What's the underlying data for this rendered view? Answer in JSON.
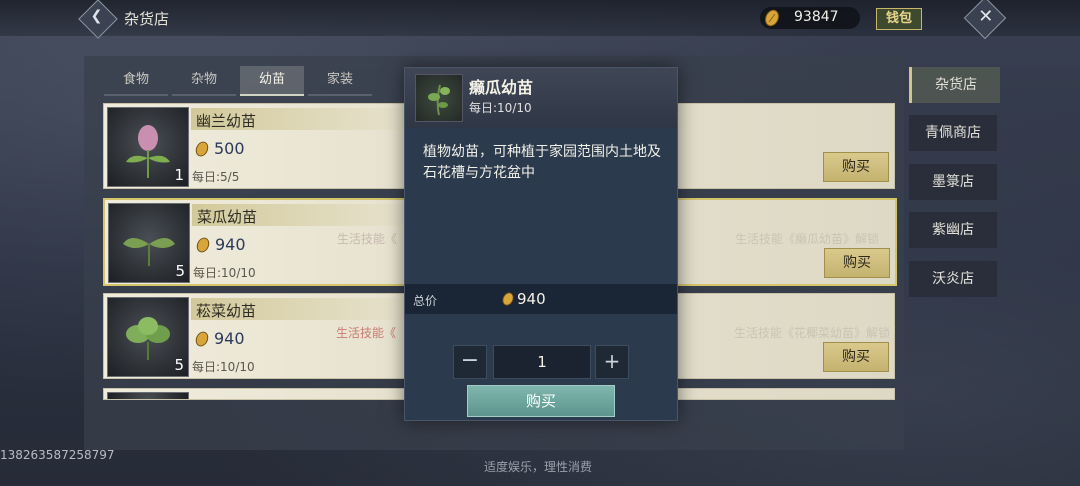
{
  "header": {
    "title": "杂货店",
    "coins": "93847",
    "wallet_label": "钱包"
  },
  "tabs": [
    "食物",
    "杂物",
    "幼苗",
    "家装"
  ],
  "active_tab": "幼苗",
  "items": [
    {
      "name": "幽兰幼苗",
      "price": "500",
      "daily": "每日:5/5",
      "qty": "1",
      "req_mid": "",
      "req_right": "",
      "buy": "购买"
    },
    {
      "name": "菜瓜幼苗",
      "price": "940",
      "daily": "每日:10/10",
      "qty": "5",
      "req_mid": "生活技能《",
      "req_right": "生活技能《癞瓜幼苗》解锁",
      "buy": "购买"
    },
    {
      "name": "菘菜幼苗",
      "price": "940",
      "daily": "每日:10/10",
      "qty": "5",
      "req_mid": "生活技能《",
      "req_right": "生活技能《花椰菜幼苗》解锁",
      "buy": "购买"
    }
  ],
  "nav": [
    "杂货店",
    "青佩商店",
    "墨箓店",
    "紫幽店",
    "沃炎店"
  ],
  "active_nav": "杂货店",
  "uid": "1382635872587​97",
  "footer_note": "适度娱乐，理性消费",
  "popup": {
    "name": "癞瓜幼苗",
    "limit": "每日:10/10",
    "description": "植物幼苗，可种植于家园范围内土地及石花槽与方花盆中",
    "total_label": "总价",
    "total_value": "940",
    "quantity": "1",
    "minus": "−",
    "plus": "+",
    "buy_label": "购买"
  },
  "colors": {
    "accent_gold": "#d4c46a",
    "buy_teal": "#6fa59e",
    "price_blue": "#2b3a5c"
  }
}
